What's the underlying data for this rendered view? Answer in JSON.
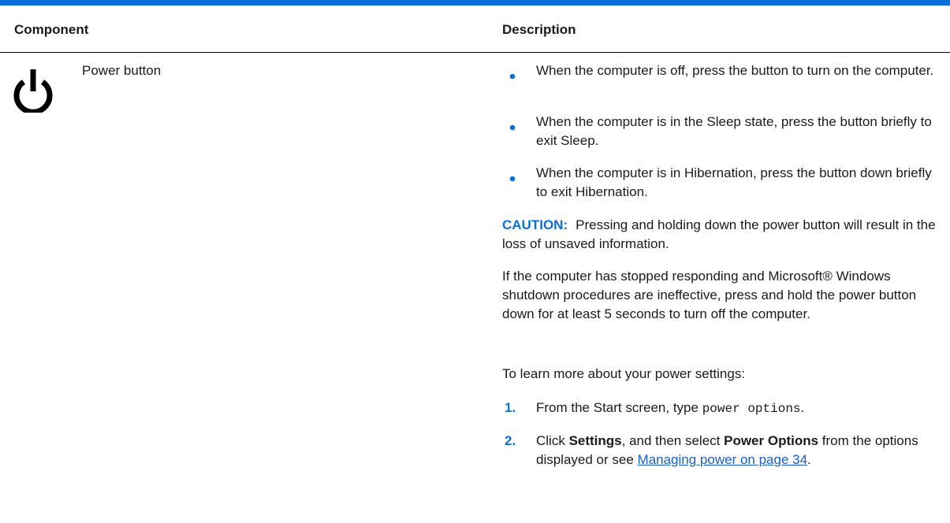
{
  "table": {
    "header_component": "Component",
    "header_description": "Description"
  },
  "component": {
    "name": "Power button",
    "icon": "power-icon"
  },
  "bullets": [
    "When the computer is off, press the button to turn on the computer.",
    "When the computer is in the Sleep state, press the button briefly to exit Sleep.",
    "When the computer is in Hibernation, press the button down briefly to exit Hibernation."
  ],
  "caution": {
    "label": "CAUTION:",
    "text": "Pressing and holding down the power button will result in the loss of unsaved information."
  },
  "unresponsive_para": "If the computer has stopped responding and Microsoft® Windows shutdown procedures are ineffective, press and hold the power button down for at least 5 seconds to turn off the computer.",
  "learn_more": "To learn more about your power settings:",
  "steps": [
    {
      "num": "1.",
      "pre": "From the Start screen, type ",
      "code": "power options",
      "post": "."
    },
    {
      "num": "2.",
      "pre": "Click ",
      "bold1": "Settings",
      "mid": ", and then select ",
      "bold2": "Power Options",
      "post": " from the options displayed or see ",
      "link": "Managing power on page 34",
      "end": "."
    }
  ],
  "colors": {
    "accent": "#0a6fd8",
    "link": "#1a5fc4"
  }
}
